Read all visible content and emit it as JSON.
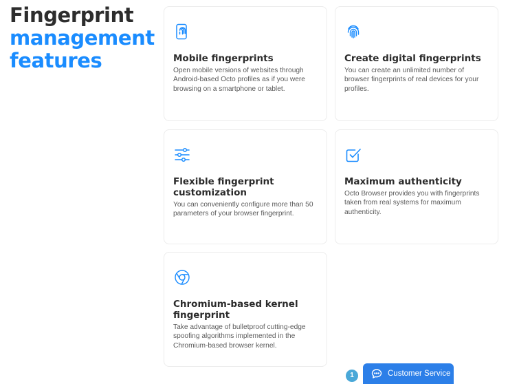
{
  "heading": {
    "line1": "Fingerprint",
    "line2": "management",
    "line3": "features"
  },
  "features": [
    {
      "title": "Mobile fingerprints",
      "description": "Open mobile versions of websites through Android-based Octo profiles as if you were browsing on a smartphone or tablet.",
      "icon": "mobile-fingerprint-icon"
    },
    {
      "title": "Create digital fingerprints",
      "description": "You can create an unlimited number of browser fingerprints of real devices for your profiles.",
      "icon": "fingerprint-icon"
    },
    {
      "title": "Flexible fingerprint customization",
      "description": "You can conveniently configure more than 50 parameters of your browser fingerprint.",
      "icon": "sliders-icon"
    },
    {
      "title": "Maximum authenticity",
      "description": "Octo Browser provides you with fingerprints taken from real systems for maximum authenticity.",
      "icon": "checkbox-icon"
    },
    {
      "title": "Chromium-based kernel fingerprint",
      "description": "Take advantage of bulletproof cutting-edge spoofing algorithms implemented in the Chromium-based browser kernel.",
      "icon": "chromium-icon"
    }
  ],
  "customer_service": {
    "badge_count": "1",
    "label": "Customer Service",
    "icon": "chat-icon"
  },
  "colors": {
    "accent": "#1a8cff",
    "button": "#2c7fe8",
    "badge": "#4aa8d8"
  }
}
